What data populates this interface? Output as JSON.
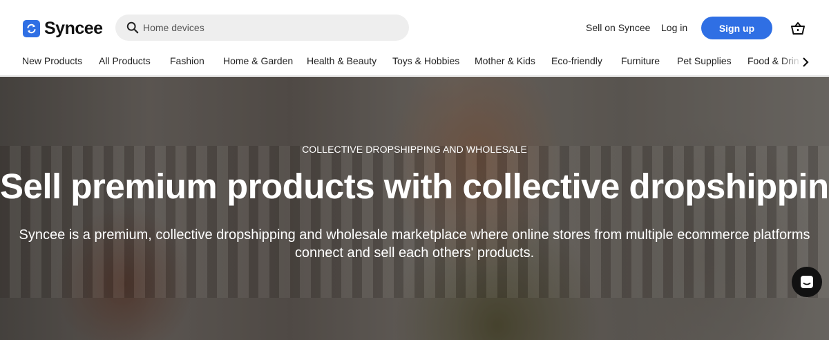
{
  "brand": {
    "name": "Syncee",
    "accent": "#2f6fe4"
  },
  "search": {
    "placeholder": "Home devices",
    "icon": "search-icon"
  },
  "header_links": {
    "sell": "Sell on Syncee",
    "login": "Log in",
    "signup": "Sign up"
  },
  "categories": [
    "New Products",
    "All Products",
    "Fashion",
    "Home & Garden",
    "Health & Beauty",
    "Toys & Hobbies",
    "Mother & Kids",
    "Eco-friendly",
    "Furniture",
    "Pet Supplies",
    "Food & Drin"
  ],
  "hero": {
    "eyebrow": "COLLECTIVE DROPSHIPPING AND WHOLESALE",
    "headline": "Sell premium products with collective dropshipping",
    "subhead_line1": "Syncee is a premium, collective dropshipping and wholesale marketplace where online stores from multiple ecommerce platforms",
    "subhead_line2": "connect and sell each others' products."
  },
  "icons": [
    "sync-logo-icon",
    "search-icon",
    "cart-icon",
    "chevron-right-icon",
    "chat-icon"
  ]
}
